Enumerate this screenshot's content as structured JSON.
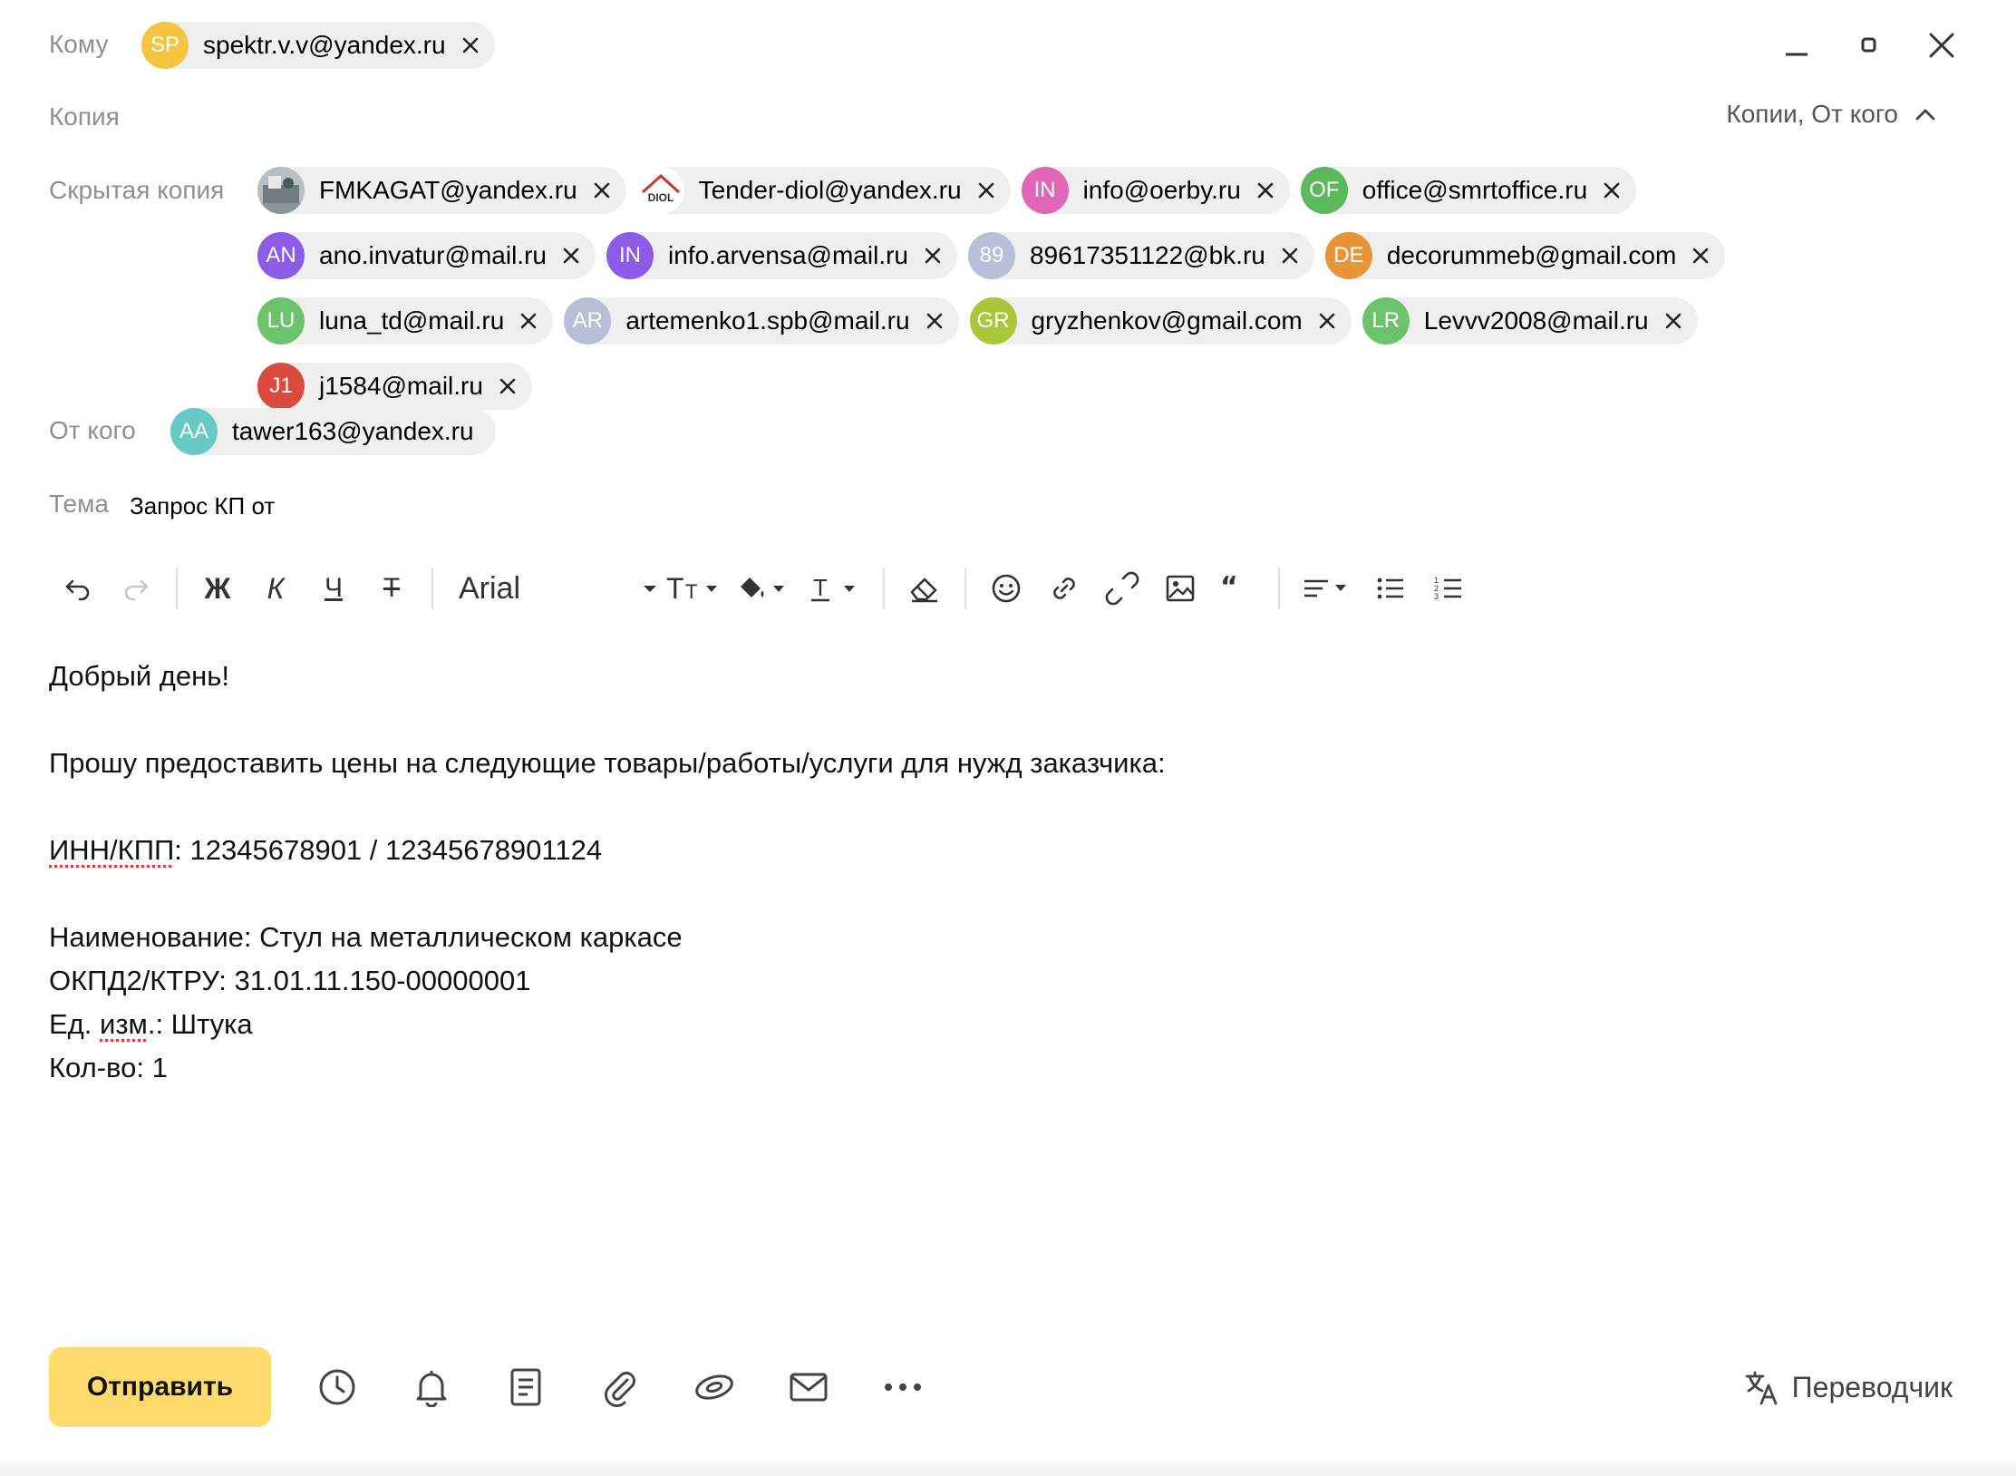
{
  "labels": {
    "to": "Кому",
    "cc": "Копия",
    "bcc": "Скрытая копия",
    "from": "От кого",
    "subject": "Тема"
  },
  "copies_toggle": "Копии, От кого",
  "to_recipients": [
    {
      "initials": "SP",
      "email": "spektr.v.v@yandex.ru",
      "color": "#f5c542"
    }
  ],
  "bcc_recipients": [
    {
      "initials": "",
      "email": "FMKAGAT@yandex.ru",
      "color": "#9aa6a8",
      "photo": true
    },
    {
      "initials": "DIOL",
      "email": "Tender-diol@yandex.ru",
      "color": "#ffffff",
      "logo": true
    },
    {
      "initials": "IN",
      "email": "info@oerby.ru",
      "color": "#e066b8"
    },
    {
      "initials": "OF",
      "email": "office@smrtoffice.ru",
      "color": "#5cb85c"
    },
    {
      "initials": "AN",
      "email": "ano.invatur@mail.ru",
      "color": "#8c5ce8"
    },
    {
      "initials": "IN",
      "email": "info.arvensa@mail.ru",
      "color": "#8c5ce8"
    },
    {
      "initials": "89",
      "email": "89617351122@bk.ru",
      "color": "#b9bfd6"
    },
    {
      "initials": "DE",
      "email": "decorummeb@gmail.com",
      "color": "#e8953a"
    },
    {
      "initials": "LU",
      "email": "luna_td@mail.ru",
      "color": "#6cc36c"
    },
    {
      "initials": "AR",
      "email": "artemenko1.spb@mail.ru",
      "color": "#b9bfd6"
    },
    {
      "initials": "GR",
      "email": "gryzhenkov@gmail.com",
      "color": "#a8c83a"
    },
    {
      "initials": "LR",
      "email": "Levvv2008@mail.ru",
      "color": "#6cc36c"
    },
    {
      "initials": "J1",
      "email": "j1584@mail.ru",
      "color": "#db4a3e"
    }
  ],
  "from_sender": {
    "initials": "AA",
    "email": "tawer163@yandex.ru",
    "color": "#66c9c4"
  },
  "subject": "Запрос КП от",
  "toolbar": {
    "font_name": "Arial",
    "bold_label": "Ж",
    "italic_label": "К",
    "underline_label": "Ч",
    "strike_label": "Т"
  },
  "body": {
    "greeting": "Добрый день!",
    "request": "Прошу предоставить цены на следующие товары/работы/услуги для нужд заказчика:",
    "inn_label": "ИНН/КПП",
    "inn_value": ": 12345678901 / 12345678901124",
    "item_name": "Наименование: Стул на металлическом каркасе",
    "okpd": "ОКПД2/КТРУ: 31.01.11.150-00000001",
    "unit_prefix": "Ед. ",
    "unit_spell": "изм",
    "unit_suffix": ".: Штука",
    "quantity": "Кол-во: 1"
  },
  "footer": {
    "send_label": "Отправить",
    "translator_label": "Переводчик"
  },
  "colors": {
    "send_button": "#ffdb6b",
    "chip_background": "#efefef",
    "label_gray": "#8f8f8f"
  }
}
